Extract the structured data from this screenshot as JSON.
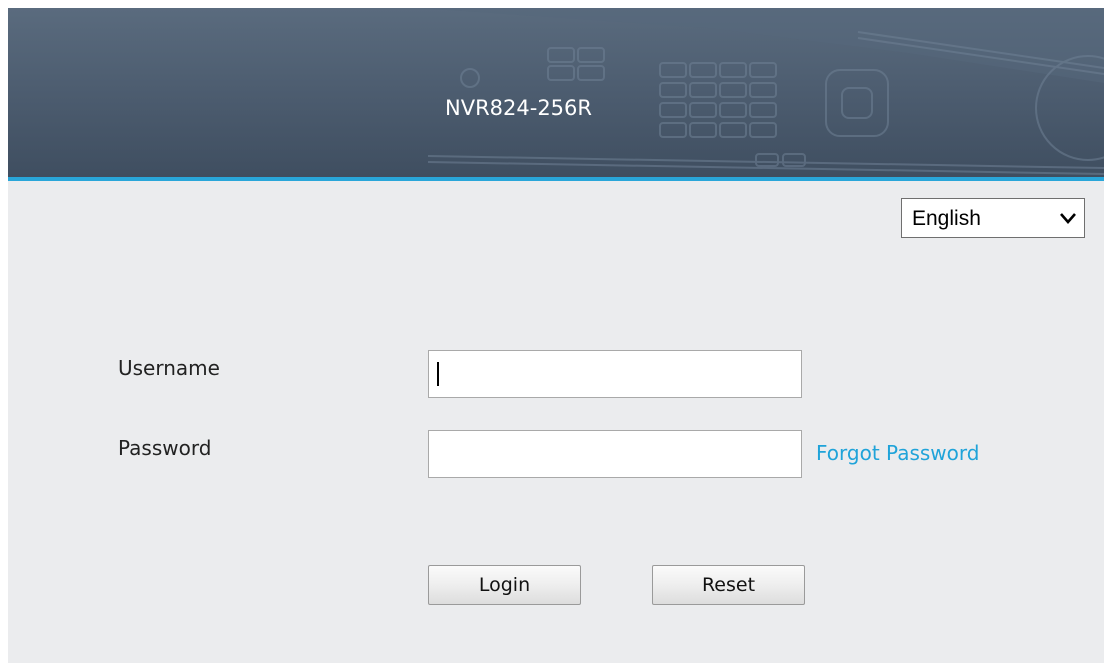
{
  "header": {
    "device_model": "NVR824-256R"
  },
  "language": {
    "selected": "English",
    "icon": "chevron-down-icon"
  },
  "form": {
    "username_label": "Username",
    "username_value": "",
    "password_label": "Password",
    "password_value": "",
    "forgot_password": "Forgot Password"
  },
  "buttons": {
    "login": "Login",
    "reset": "Reset"
  },
  "colors": {
    "header": "#4b5b6e",
    "accent": "#29a6d9",
    "link": "#1fa3d9",
    "background": "#ebecee"
  }
}
